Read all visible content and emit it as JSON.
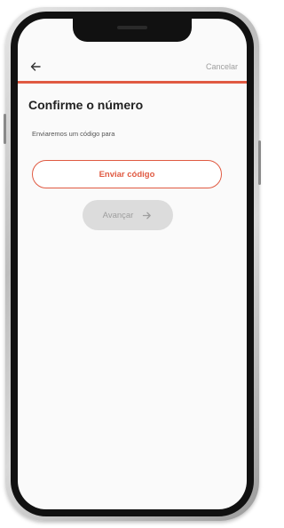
{
  "nav": {
    "back_icon": "arrow-left-icon",
    "cancel_label": "Cancelar"
  },
  "main": {
    "title": "Confirme o número",
    "subtitle": "Enviaremos um código para",
    "send_code_label": "Enviar código",
    "next_label": "Avançar",
    "next_icon": "arrow-right-icon"
  },
  "colors": {
    "accent": "#e05a42",
    "disabled_bg": "#dcdcdc",
    "disabled_text": "#9e9e9e"
  }
}
